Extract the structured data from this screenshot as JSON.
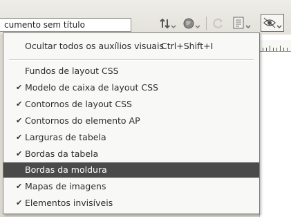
{
  "document": {
    "title": "cumento sem título"
  },
  "toolbar": {
    "icons": [
      "file-management-icon",
      "globe-preview-icon",
      "refresh-icon",
      "view-options-icon",
      "visual-aids-icon"
    ]
  },
  "menu": {
    "top_item": {
      "label": "Ocultar todos os auxílios visuais",
      "shortcut": "Ctrl+Shift+I"
    },
    "items": [
      {
        "label": "Fundos de layout CSS",
        "checked": false,
        "check": ""
      },
      {
        "label": "Modelo de caixa de layout CSS",
        "checked": true,
        "check": "✔"
      },
      {
        "label": "Contornos de layout CSS",
        "checked": true,
        "check": "✔"
      },
      {
        "label": "Contornos do elemento AP",
        "checked": true,
        "check": "✔"
      },
      {
        "label": "Larguras de tabela",
        "checked": true,
        "check": "✔"
      },
      {
        "label": "Bordas da tabela",
        "checked": true,
        "check": "✔"
      },
      {
        "label": "Bordas da moldura",
        "checked": false,
        "check": "",
        "selected": true
      },
      {
        "label": "Mapas de imagens",
        "checked": true,
        "check": "✔"
      },
      {
        "label": "Elementos invisíveis",
        "checked": true,
        "check": "✔"
      }
    ]
  },
  "colors": {
    "highlight": "#4a4a4a",
    "menu_bg": "#f8f8f6"
  }
}
